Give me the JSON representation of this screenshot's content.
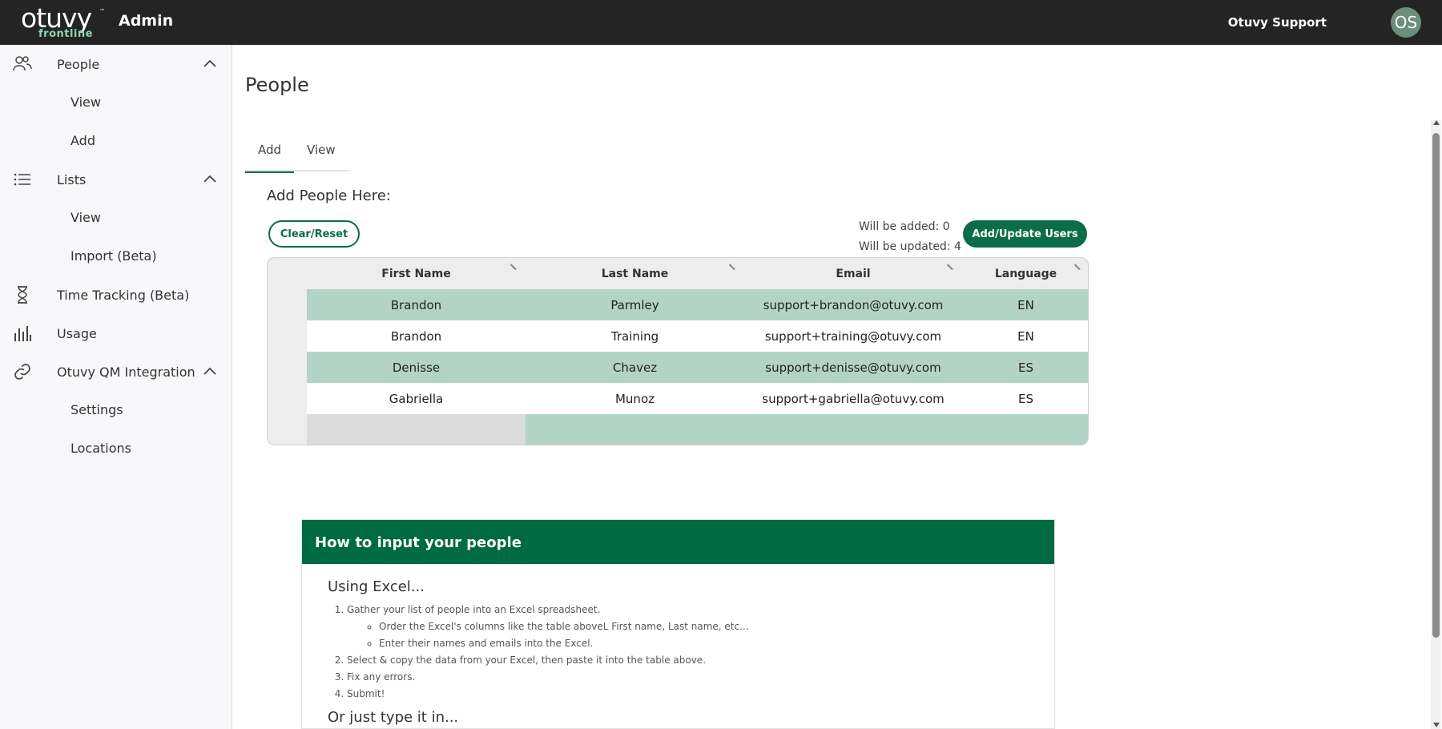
{
  "header": {
    "logo_text": "otuvy",
    "logo_sub": "frontline",
    "logo_tm": "™",
    "title": "Admin",
    "user_name": "Otuvy Support",
    "avatar_initials": "OS"
  },
  "sidebar": {
    "items": [
      {
        "label": "People",
        "icon": "people-icon",
        "expanded": true,
        "children": [
          {
            "label": "View"
          },
          {
            "label": "Add"
          }
        ]
      },
      {
        "label": "Lists",
        "icon": "list-icon",
        "expanded": true,
        "children": [
          {
            "label": "View"
          },
          {
            "label": "Import (Beta)"
          }
        ]
      },
      {
        "label": "Time Tracking (Beta)",
        "icon": "hourglass-icon"
      },
      {
        "label": "Usage",
        "icon": "bar-chart-icon"
      },
      {
        "label": "Otuvy QM Integration",
        "icon": "link-icon",
        "expanded": true,
        "children": [
          {
            "label": "Settings"
          },
          {
            "label": "Locations"
          }
        ]
      }
    ]
  },
  "main": {
    "page_title": "People",
    "tabs": [
      {
        "label": "Add",
        "active": true
      },
      {
        "label": "View",
        "active": false
      }
    ],
    "section_title": "Add People Here:",
    "clear_button": "Clear/Reset",
    "add_button": "Add/Update Users",
    "will_be_added": "Will be added: 0",
    "will_be_updated": "Will be updated: 4",
    "table": {
      "columns": [
        "First Name",
        "Last Name",
        "Email",
        "Language"
      ],
      "rows": [
        [
          "Brandon",
          "Parmley",
          "support+brandon@otuvy.com",
          "EN"
        ],
        [
          "Brandon",
          "Training",
          "support+training@otuvy.com",
          "EN"
        ],
        [
          "Denisse",
          "Chavez",
          "support+denisse@otuvy.com",
          "ES"
        ],
        [
          "Gabriella",
          "Munoz",
          "support+gabriella@otuvy.com",
          "ES"
        ]
      ]
    },
    "howto": {
      "title": "How to input your people",
      "subtitle": "Using Excel...",
      "step1": "Gather your list of people into an Excel spreadsheet.",
      "step1_sub1": "Order the Excel's columns like the table aboveL First name, Last name, etc...",
      "step1_sub2": "Enter their names and emails into the Excel.",
      "step2": "Select & copy the data from your Excel, then paste it into the table above.",
      "step3": "Fix any errors.",
      "step4": "Submit!",
      "subtitle2": "Or just type it in..."
    }
  },
  "colors": {
    "brand_green": "#0a6c48",
    "row_green": "#b2d4c6",
    "topbar": "#242424"
  }
}
